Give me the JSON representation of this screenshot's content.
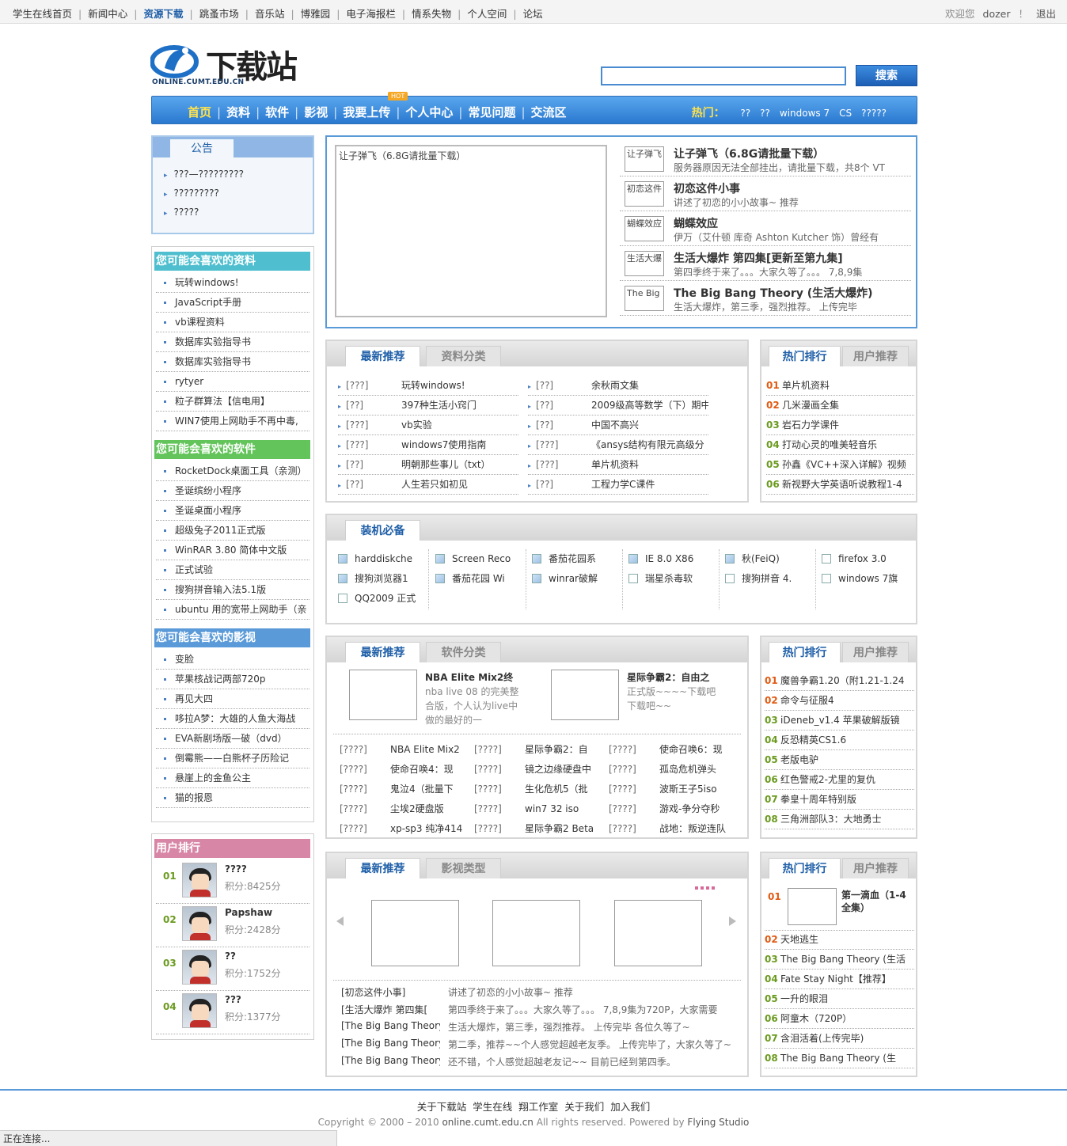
{
  "topnav": {
    "items": [
      "学生在线首页",
      "新闻中心",
      "资源下载",
      "跳蚤市场",
      "音乐站",
      "博雅园",
      "电子海报栏",
      "情系失物",
      "个人空间",
      "论坛"
    ],
    "welcome": "欢迎您",
    "username": "dozer",
    "excl": "！",
    "logout": "退出"
  },
  "header": {
    "logo_text": "下载站",
    "logo_url": "ONLINE.CUMT.EDU.CN",
    "search_placeholder": "",
    "search_btn": "搜索"
  },
  "mainnav": {
    "items": [
      "首页",
      "资料",
      "软件",
      "影视",
      "我要上传",
      "个人中心",
      "常见问题",
      "交流区"
    ],
    "hot_badge": "HOT",
    "hot_label": "热门：",
    "hot_keywords": [
      "??",
      "??",
      "windows 7",
      "CS",
      "?????"
    ]
  },
  "notice": {
    "title": "公告",
    "items": [
      "???—?????????",
      "?????????",
      "?????"
    ]
  },
  "side": {
    "docs_title": "您可能会喜欢的资料",
    "docs": [
      "玩转windows!",
      "JavaScript手册",
      "vb课程资料",
      "数据库实验指导书",
      "数据库实验指导书",
      "rytyer",
      "粒子群算法【信电用】",
      "WIN7使用上网助手不再中毒,"
    ],
    "soft_title": "您可能会喜欢的软件",
    "soft": [
      "RocketDock桌面工具（亲测）",
      "圣诞缤纷小程序",
      "圣诞桌面小程序",
      "超级兔子2011正式版",
      "WinRAR 3.80 简体中文版",
      "正式试验",
      "搜狗拼音输入法5.1版",
      "ubuntu 用的宽带上网助手（亲"
    ],
    "video_title": "您可能会喜欢的影视",
    "video": [
      "变脸",
      "苹果核战记两部720p",
      "再见大四",
      "哆拉A梦：大雄的人鱼大海战",
      "EVA新剧场版—破（dvd）",
      "倒霉熊——白熊杯子历险记",
      "悬崖上的金鱼公主",
      "猫的报恩"
    ],
    "rank_title": "用户排行",
    "ranks": [
      {
        "no": "01",
        "name": "????",
        "score": "积分:8425分"
      },
      {
        "no": "02",
        "name": "Papshaw",
        "score": "积分:2428分"
      },
      {
        "no": "03",
        "name": "??",
        "score": "积分:1752分"
      },
      {
        "no": "04",
        "name": "???",
        "score": "积分:1377分"
      }
    ]
  },
  "feature": {
    "image_alt": "让子弹飞（6.8G请批量下载）",
    "items": [
      {
        "thumb": "让子弹飞",
        "title": "让子弹飞（6.8G请批量下载）",
        "desc": "服务器原因无法全部挂出，请批量下载，共8个 VT"
      },
      {
        "thumb": "初恋这件",
        "title": "初恋这件小事",
        "desc": "讲述了初恋的小小故事~ 推荐"
      },
      {
        "thumb": "蝴蝶效应",
        "title": "蝴蝶效应",
        "desc": "伊万（艾什顿 库奇 Ashton Kutcher 饰）曾经有"
      },
      {
        "thumb": "生活大爆",
        "title": "生活大爆炸 第四集[更新至第九集]",
        "desc": "第四季终于来了。。。大家久等了。。。 7,8,9集"
      },
      {
        "thumb": "The Big",
        "title": "The Big Bang Theory (生活大爆炸)",
        "desc": "生活大爆炸，第三季，强烈推荐。 上传完毕"
      }
    ]
  },
  "docs_panel": {
    "tab_on": "最新推荐",
    "tab_off": "资料分类",
    "left": [
      {
        "cat": "[???]",
        "name": "玩转windows!"
      },
      {
        "cat": "[??]",
        "name": "397种生活小窍门"
      },
      {
        "cat": "[???]",
        "name": "vb实验"
      },
      {
        "cat": "[???]",
        "name": "windows7使用指南"
      },
      {
        "cat": "[??]",
        "name": "明朝那些事儿（txt）"
      },
      {
        "cat": "[??]",
        "name": "人生若只如初见"
      }
    ],
    "right": [
      {
        "cat": "[??]",
        "name": "余秋雨文集"
      },
      {
        "cat": "[??]",
        "name": "2009级高等数学（下）期中"
      },
      {
        "cat": "[??]",
        "name": "中国不高兴"
      },
      {
        "cat": "[???]",
        "name": "《ansys结构有限元高级分"
      },
      {
        "cat": "[???]",
        "name": "单片机资料"
      },
      {
        "cat": "[??]",
        "name": "工程力学C课件"
      }
    ]
  },
  "docs_hot": {
    "tab_on": "热门排行",
    "tab_off": "用户推荐",
    "items": [
      {
        "no": "01",
        "name": "单片机资料"
      },
      {
        "no": "02",
        "name": "几米漫画全集"
      },
      {
        "no": "03",
        "name": "岩石力学课件"
      },
      {
        "no": "04",
        "name": "打动心灵的唯美轻音乐"
      },
      {
        "no": "05",
        "name": "孙鑫《VC++深入详解》视频"
      },
      {
        "no": "06",
        "name": "新视野大学英语听说教程1-4"
      }
    ]
  },
  "essentials": {
    "tab": "装机必备",
    "cols": [
      [
        "harddiskche",
        "搜狗浏览器1",
        "QQ2009 正式"
      ],
      [
        "Screen Reco",
        "番茄花园 Wi"
      ],
      [
        "番茄花园系",
        "winrar破解"
      ],
      [
        "IE 8.0 X86",
        "瑞星杀毒软"
      ],
      [
        "秋(FeiQ)",
        "搜狗拼音 4."
      ],
      [
        "firefox 3.0",
        "windows 7旗"
      ]
    ]
  },
  "soft_panel": {
    "tab_on": "最新推荐",
    "tab_off": "软件分类",
    "feat1_title": "NBA Elite Mix2终",
    "feat1_desc": [
      "nba live 08 的完美整",
      "合版，个人认为live中",
      "做的最好的一"
    ],
    "feat2_title": "星际争霸2：自由之",
    "feat2_desc": [
      "正式版~~~~下载吧",
      "下载吧~~"
    ],
    "col1": [
      {
        "cat": "[????]",
        "name": "NBA Elite Mix2"
      },
      {
        "cat": "[????]",
        "name": "使命召唤4：现"
      },
      {
        "cat": "[????]",
        "name": "鬼泣4（批量下"
      },
      {
        "cat": "[????]",
        "name": "尘埃2硬盘版"
      },
      {
        "cat": "[????]",
        "name": "xp-sp3 纯净414"
      }
    ],
    "col2": [
      {
        "cat": "[????]",
        "name": "星际争霸2：自"
      },
      {
        "cat": "[????]",
        "name": "镜之边缘硬盘中"
      },
      {
        "cat": "[????]",
        "name": "生化危机5（批"
      },
      {
        "cat": "[????]",
        "name": "win7 32 iso"
      },
      {
        "cat": "[????]",
        "name": "星际争霸2 Beta"
      }
    ],
    "col3": [
      {
        "cat": "[????]",
        "name": "使命召唤6：现"
      },
      {
        "cat": "[????]",
        "name": "孤岛危机弹头"
      },
      {
        "cat": "[????]",
        "name": "波斯王子5iso"
      },
      {
        "cat": "[????]",
        "name": "游戏-争分夺秒"
      },
      {
        "cat": "[????]",
        "name": "战地：叛逆连队"
      }
    ]
  },
  "soft_hot": {
    "tab_on": "热门排行",
    "tab_off": "用户推荐",
    "items": [
      {
        "no": "01",
        "name": "魔兽争霸1.20（附1.21-1.24"
      },
      {
        "no": "02",
        "name": "命令与征服4"
      },
      {
        "no": "03",
        "name": "iDeneb_v1.4 苹果破解版镜"
      },
      {
        "no": "04",
        "name": "反恐精英CS1.6"
      },
      {
        "no": "05",
        "name": "老版电驴"
      },
      {
        "no": "06",
        "name": "红色警戒2-尤里的复仇"
      },
      {
        "no": "07",
        "name": "拳皇十周年特别版"
      },
      {
        "no": "08",
        "name": "三角洲部队3：大地勇士"
      }
    ]
  },
  "video_panel": {
    "tab_on": "最新推荐",
    "tab_off": "影视类型",
    "rows": [
      {
        "title": "[初恋这件小事]",
        "desc": "讲述了初恋的小小故事~ 推荐"
      },
      {
        "title": "[生活大爆炸 第四集[",
        "desc": "第四季终于来了。。。大家久等了。。。 7,8,9集为720P，大家需要"
      },
      {
        "title": "[The Big Bang Theory]",
        "desc": "生活大爆炸，第三季，强烈推荐。 上传完毕 各位久等了~"
      },
      {
        "title": "[The Big Bang Theory]",
        "desc": "第二季，推荐~~个人感觉超越老友季。 上传完毕了，大家久等了~"
      },
      {
        "title": "[The Big Bang Theory]",
        "desc": "还不错，个人感觉超越老友记~~ 目前已经到第四季。"
      }
    ]
  },
  "video_hot": {
    "tab_on": "热门排行",
    "tab_off": "用户推荐",
    "first": {
      "no": "01",
      "name": "第一滴血（1-4全集）"
    },
    "items": [
      {
        "no": "02",
        "name": "天地逃生"
      },
      {
        "no": "03",
        "name": "The Big Bang Theory (生活"
      },
      {
        "no": "04",
        "name": "Fate Stay Night【推荐】"
      },
      {
        "no": "05",
        "name": "一升的眼泪"
      },
      {
        "no": "06",
        "name": "阿童木（720P）"
      },
      {
        "no": "07",
        "name": "含泪活着(上传完毕)"
      },
      {
        "no": "08",
        "name": "The Big Bang Theory (生"
      }
    ]
  },
  "footer": {
    "links": [
      "关于下载站",
      "学生在线",
      "翔工作室",
      "关于我们",
      "加入我们"
    ],
    "copyright": "Copyright © 2000 – 2010",
    "domain": "online.cumt.edu.cn",
    "rights": "All rights reserved. Powered by",
    "studio": "Flying Studio"
  },
  "status": "正在连接..."
}
